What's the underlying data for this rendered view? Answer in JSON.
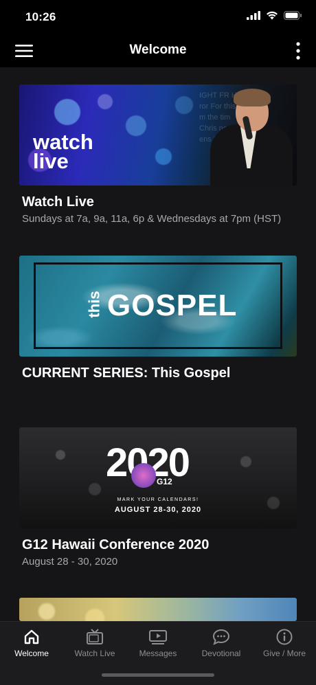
{
  "status_bar": {
    "time": "10:26"
  },
  "nav": {
    "title": "Welcome"
  },
  "cards": [
    {
      "image_text": "watch live",
      "title": "Watch Live",
      "subtitle": "Sundays at 7a, 9a, 11a, 6p & Wednesdays at 7pm (HST)"
    },
    {
      "image_text_small": "this",
      "image_text_large": "GOSPEL",
      "title": "CURRENT SERIES:  This Gospel",
      "subtitle": ""
    },
    {
      "image_text_large": "2020",
      "image_text_logo": "G12",
      "image_text_mark": "MARK YOUR CALENDARS!",
      "image_text_dates": "AUGUST 28-30, 2020",
      "title": "G12 Hawaii Conference 2020",
      "subtitle": "August 28 - 30, 2020"
    }
  ],
  "tabs": [
    {
      "label": "Welcome",
      "icon": "home-icon",
      "active": true
    },
    {
      "label": "Watch Live",
      "icon": "tv-icon",
      "active": false
    },
    {
      "label": "Messages",
      "icon": "video-play-icon",
      "active": false
    },
    {
      "label": "Devotional",
      "icon": "chat-bubble-icon",
      "active": false
    },
    {
      "label": "Give / More",
      "icon": "info-icon",
      "active": false
    }
  ],
  "colors": {
    "background": "#151517",
    "bar": "#000000",
    "tab_bar": "#1c1c1e",
    "inactive": "#8e8e93",
    "active": "#ffffff"
  }
}
